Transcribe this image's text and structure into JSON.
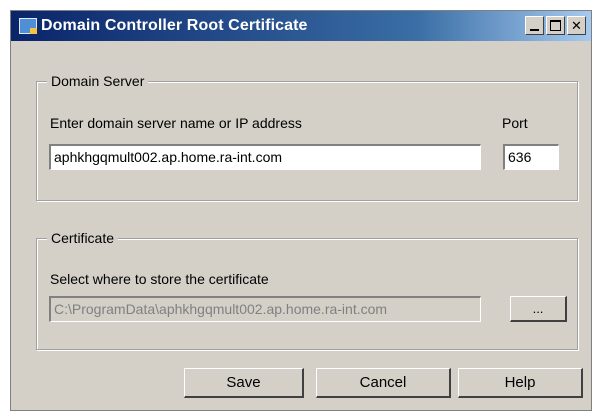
{
  "window": {
    "title": "Domain Controller Root Certificate",
    "controls": {
      "minimize": "_",
      "maximize": "□",
      "close": "✕"
    }
  },
  "domain_server": {
    "legend": "Domain Server",
    "name_label": "Enter domain server name or IP address",
    "name_value": "aphkhgqmult002.ap.home.ra-int.com",
    "port_label": "Port",
    "port_value": "636"
  },
  "certificate": {
    "legend": "Certificate",
    "path_label": "Select where to store the certificate",
    "path_value": "C:\\ProgramData\\aphkhgqmult002.ap.home.ra-int.com",
    "browse_label": "..."
  },
  "buttons": {
    "save": "Save",
    "cancel": "Cancel",
    "help": "Help"
  }
}
